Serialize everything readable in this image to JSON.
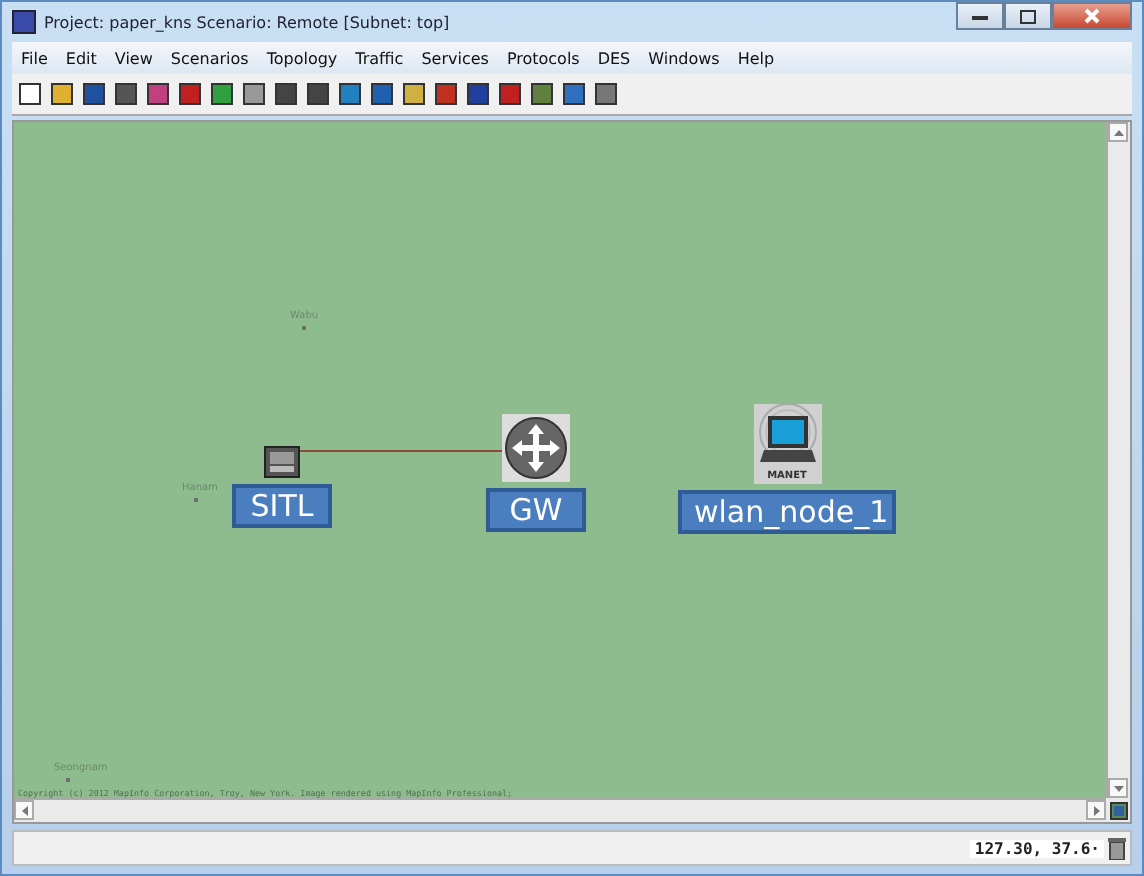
{
  "window": {
    "title": "Project: paper_kns Scenario: Remote  [Subnet: top]"
  },
  "menu": [
    "File",
    "Edit",
    "View",
    "Scenarios",
    "Topology",
    "Traffic",
    "Services",
    "Protocols",
    "DES",
    "Windows",
    "Help"
  ],
  "map": {
    "places": [
      "Wabu",
      "Hanam",
      "Seongnam"
    ],
    "copyright": "Copyright (c) 2012 MapInfo Corporation, Troy, New York. Image rendered using MapInfo Professional;"
  },
  "nodes": [
    {
      "label": "SITL",
      "kind": "workstation"
    },
    {
      "label": "GW",
      "kind": "router"
    },
    {
      "label": "wlan_node_1",
      "kind": "manet",
      "badge": "MANET"
    }
  ],
  "status_bar": {
    "coordinates": "127.30, 37.6·"
  }
}
